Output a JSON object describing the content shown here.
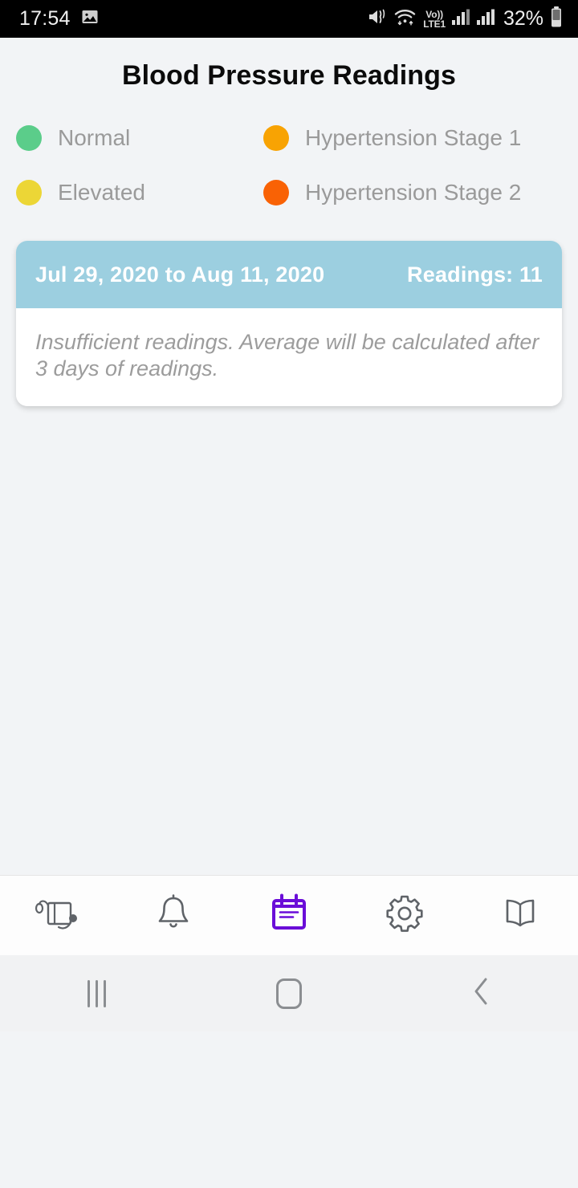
{
  "status_bar": {
    "time": "17:54",
    "image_icon": "image-icon",
    "mute_icon": "mute-icon",
    "wifi_icon": "wifi-icon",
    "volte_top": "Vo))",
    "volte_bottom": "LTE1",
    "signal_icon_1": "signal-bars-icon",
    "signal_icon_2": "signal-bars-icon",
    "battery_percent": "32%",
    "battery_icon": "battery-icon",
    "background_color": "#000000",
    "text_color": "#f0f0f0"
  },
  "header": {
    "title": "Blood Pressure Readings"
  },
  "legend": {
    "items": [
      {
        "label": "Normal",
        "color": "#5bcd8a",
        "icon": "legend-dot-normal"
      },
      {
        "label": "Hypertension Stage 1",
        "color": "#f8a303",
        "icon": "legend-dot-stage-1"
      },
      {
        "label": "Elevated",
        "color": "#ecd636",
        "icon": "legend-dot-elevated"
      },
      {
        "label": "Hypertension Stage 2",
        "color": "#f96205",
        "icon": "legend-dot-stage-2"
      }
    ]
  },
  "card": {
    "date_range": "Jul 29, 2020 to Aug 11, 2020",
    "readings_label": "Readings: 11",
    "message": "Insufficient readings. Average will be calculated after 3 days of readings.",
    "header_color": "#9ccfe0",
    "body_color": "#ffffff"
  },
  "tab_bar": {
    "active_color": "#6a0dd8",
    "inactive_color": "#5f6368",
    "items": [
      {
        "name": "bp-monitor",
        "icon": "blood-pressure-monitor-icon",
        "active": false
      },
      {
        "name": "reminders",
        "icon": "bell-icon",
        "active": false
      },
      {
        "name": "readings",
        "icon": "notepad-calendar-icon",
        "active": true
      },
      {
        "name": "settings",
        "icon": "gear-icon",
        "active": false
      },
      {
        "name": "guide",
        "icon": "book-icon",
        "active": false
      }
    ]
  },
  "nav_bar": {
    "recents": "recents-icon",
    "home": "home-icon",
    "back": "back-icon",
    "background_color": "#f1f2f3",
    "glyph_color": "#8b8e91"
  },
  "page": {
    "background_color": "#f2f4f6"
  }
}
